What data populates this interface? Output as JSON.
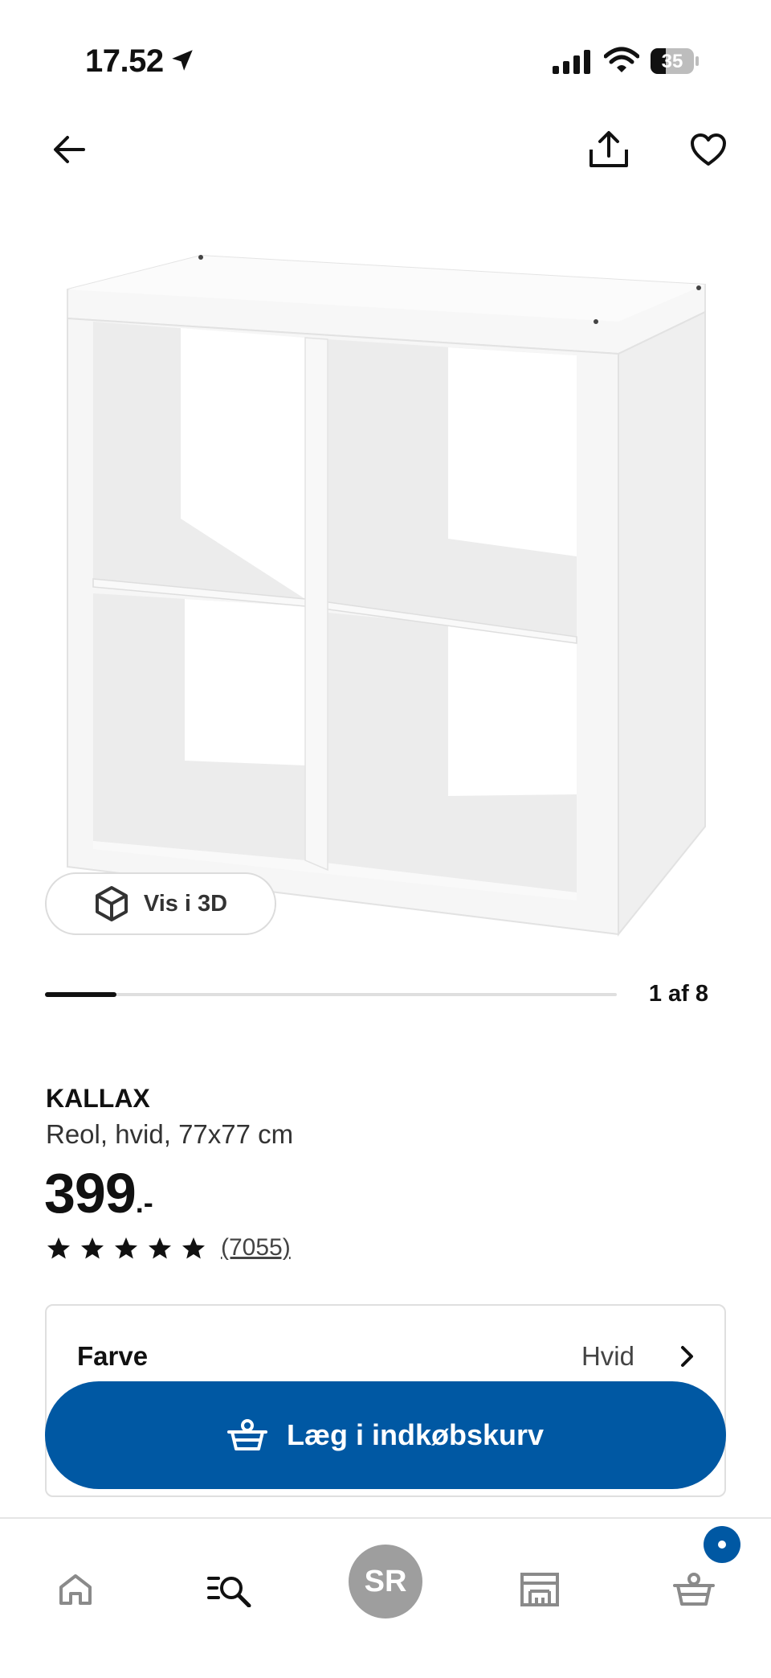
{
  "status_bar": {
    "time": "17.52",
    "battery": "35",
    "battery_level": 0.35,
    "icons": [
      "location-arrow-icon",
      "signal-icon",
      "wifi-icon",
      "battery-icon"
    ]
  },
  "top_nav": {
    "icons": [
      "arrow-left-icon",
      "share-icon",
      "heart-icon"
    ]
  },
  "gallery": {
    "view_3d_label": "Vis i 3D",
    "view_3d_icon": "cube-icon",
    "current_index": 1,
    "total": 8,
    "counter": "1 af 8"
  },
  "product": {
    "name": "KALLAX",
    "description": "Reol, hvid, 77x77 cm",
    "price": "399",
    "price_suffix": ".-",
    "rating": 5,
    "review_count": "(7055)"
  },
  "options": {
    "color_label": "Farve",
    "color_value": "Hvid",
    "chevron_icon": "chevron-right-icon"
  },
  "add_to_cart": {
    "label": "Læg i indkøbskurv",
    "icon": "basket-icon"
  },
  "tab_bar": {
    "profile_initials": "SR",
    "icons": [
      "home-icon",
      "search-list-icon",
      "store-icon",
      "basket-icon"
    ]
  },
  "colors": {
    "brand_blue": "#0058a3",
    "avatar_gray": "#9e9e9e",
    "text": "#111111"
  }
}
